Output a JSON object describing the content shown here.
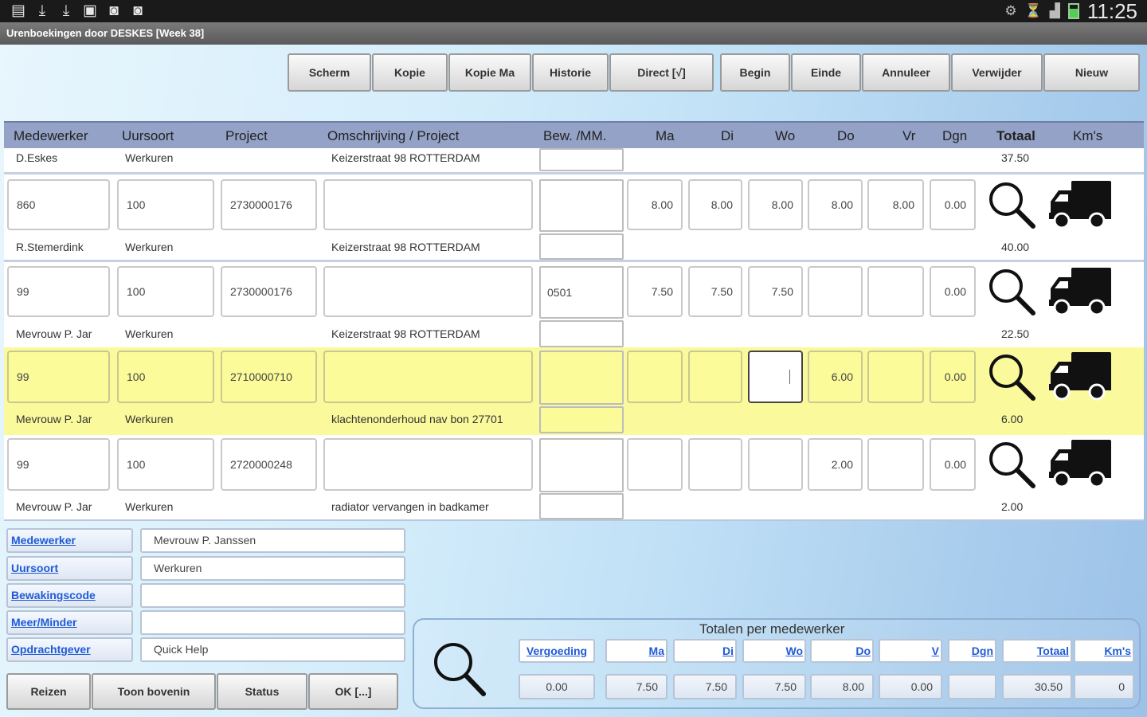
{
  "status_bar": {
    "time": "11:25"
  },
  "title": "Urenboekingen door DESKES  [Week 38]",
  "toolbar": [
    {
      "label": "Scherm"
    },
    {
      "label": "Kopie"
    },
    {
      "label": "Kopie Ma"
    },
    {
      "label": "Historie"
    },
    {
      "label": "Direct [√]"
    },
    {
      "label": "Begin"
    },
    {
      "label": "Einde"
    },
    {
      "label": "Annuleer"
    },
    {
      "label": "Verwijder"
    },
    {
      "label": "Nieuw"
    }
  ],
  "columns": {
    "medewerker": "Medewerker",
    "uursoort": "Uursoort",
    "project": "Project",
    "omschrijving": "Omschrijving / Project",
    "bew": "Bew. /MM.",
    "ma": "Ma",
    "di": "Di",
    "wo": "Wo",
    "do": "Do",
    "vr": "Vr",
    "dgn": "Dgn",
    "totaal": "Totaal",
    "kms": "Km's"
  },
  "top_label": {
    "name": "D.Eskes",
    "uursoort": "Werkuren",
    "omschrijving": "Keizerstraat 98 ROTTERDAM",
    "totaal": "37.50"
  },
  "rows": [
    {
      "medewerker": "860",
      "uursoort": "100",
      "project": "2730000176",
      "omschrijving": "",
      "bew": "",
      "ma": "8.00",
      "di": "8.00",
      "wo": "8.00",
      "do": "8.00",
      "vr": "8.00",
      "dgn": "0.00",
      "sub_name": "R.Stemerdink",
      "sub_uursoort": "Werkuren",
      "sub_omschrijving": "Keizerstraat 98 ROTTERDAM",
      "sub_totaal": "40.00"
    },
    {
      "medewerker": "99",
      "uursoort": "100",
      "project": "2730000176",
      "omschrijving": "",
      "bew": "0501",
      "ma": "7.50",
      "di": "7.50",
      "wo": "7.50",
      "do": "",
      "vr": "",
      "dgn": "0.00",
      "sub_name": "Mevrouw P. Jar",
      "sub_uursoort": "Werkuren",
      "sub_omschrijving": "Keizerstraat 98 ROTTERDAM",
      "sub_totaal": "22.50"
    },
    {
      "medewerker": "99",
      "uursoort": "100",
      "project": "2710000710",
      "omschrijving": "",
      "bew": "",
      "ma": "",
      "di": "",
      "wo": "",
      "do": "6.00",
      "vr": "",
      "dgn": "0.00",
      "sub_name": "Mevrouw P. Jar",
      "sub_uursoort": "Werkuren",
      "sub_omschrijving": "klachtenonderhoud nav bon 27701",
      "sub_totaal": "6.00"
    },
    {
      "medewerker": "99",
      "uursoort": "100",
      "project": "2720000248",
      "omschrijving": "",
      "bew": "",
      "ma": "",
      "di": "",
      "wo": "",
      "do": "2.00",
      "vr": "",
      "dgn": "0.00",
      "sub_name": "Mevrouw P. Jar",
      "sub_uursoort": "Werkuren",
      "sub_omschrijving": "radiator vervangen in badkamer",
      "sub_totaal": "2.00"
    }
  ],
  "form": [
    {
      "label": "Medewerker",
      "value": "Mevrouw P. Janssen"
    },
    {
      "label": "Uursoort",
      "value": "Werkuren"
    },
    {
      "label": "Bewakingscode",
      "value": ""
    },
    {
      "label": "Meer/Minder",
      "value": ""
    },
    {
      "label": "Opdrachtgever",
      "value": "Quick Help"
    }
  ],
  "bottom_buttons": [
    {
      "label": "Reizen"
    },
    {
      "label": "Toon bovenin"
    },
    {
      "label": "Status"
    },
    {
      "label": "OK [...]"
    }
  ],
  "totals": {
    "title": "Totalen per medewerker",
    "headers": [
      "Vergoeding",
      "Ma",
      "Di",
      "Wo",
      "Do",
      "V",
      "Dgn",
      "Totaal",
      "Km's"
    ],
    "values": [
      "0.00",
      "7.50",
      "7.50",
      "7.50",
      "8.00",
      "0.00",
      "",
      "30.50",
      "0"
    ]
  },
  "icons": {
    "search": "magnifier-icon",
    "truck": "truck-icon"
  }
}
